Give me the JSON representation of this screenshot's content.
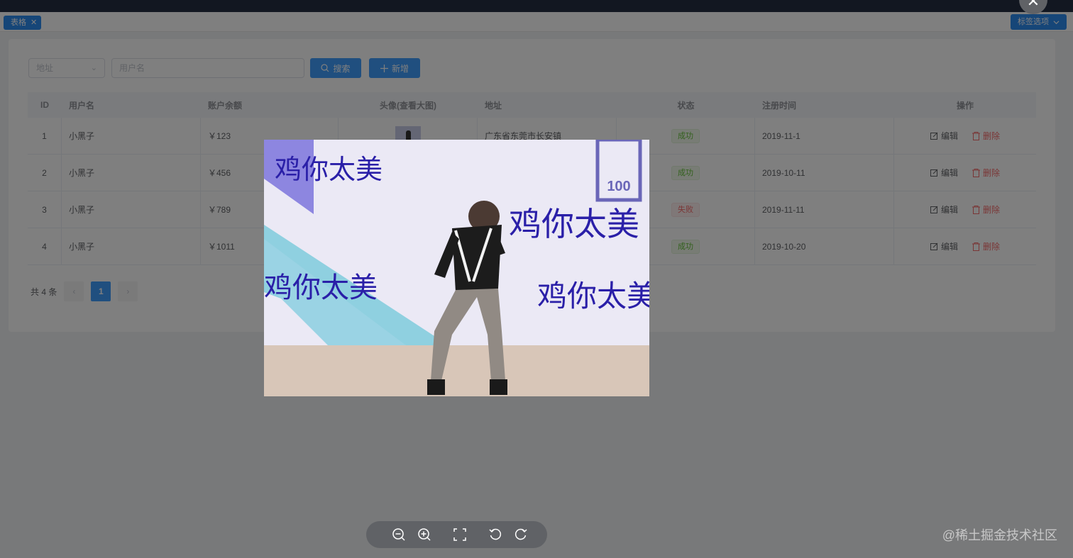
{
  "tags": {
    "active_tag": "表格",
    "tag_close": "✕",
    "options_label": "标签选项"
  },
  "search": {
    "address_placeholder": "地址",
    "username_placeholder": "用户名",
    "search_label": "搜索",
    "add_label": "新增"
  },
  "table": {
    "columns": [
      "ID",
      "用户名",
      "账户余额",
      "头像(查看大图)",
      "地址",
      "状态",
      "注册时间",
      "操作"
    ],
    "rows": [
      {
        "id": "1",
        "name": "小黑子",
        "balance": "￥123",
        "address": "广东省东莞市长安镇",
        "state": "成功",
        "date": "2019-11-1"
      },
      {
        "id": "2",
        "name": "小黑子",
        "balance": "￥456",
        "address": "",
        "state": "成功",
        "date": "2019-10-11"
      },
      {
        "id": "3",
        "name": "小黑子",
        "balance": "￥789",
        "address": "",
        "state": "失败",
        "date": "2019-11-11"
      },
      {
        "id": "4",
        "name": "小黑子",
        "balance": "￥1011",
        "address": "",
        "state": "成功",
        "date": "2019-10-20"
      }
    ],
    "edit_label": "编辑",
    "delete_label": "删除"
  },
  "pagination": {
    "total_label": "共 4 条",
    "current_page": "1",
    "prev": "‹",
    "next": "›"
  },
  "viewer": {
    "caption_1": "鸡你太美",
    "caption_2": "鸡你太美",
    "caption_3": "鸡你太美",
    "caption_4": "鸡你太美",
    "logo_text": "100",
    "close_glyph": "✕"
  },
  "watermark": "@稀土掘金技术社区",
  "colors": {
    "primary": "#409eff",
    "success": "#67c23a",
    "danger": "#f56c6c",
    "caption": "#2a1fa8"
  }
}
